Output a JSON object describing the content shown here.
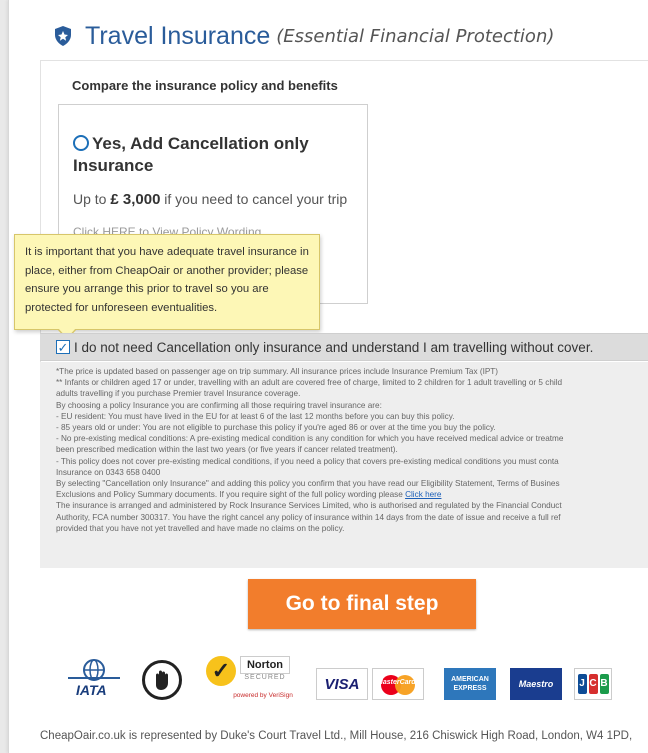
{
  "header": {
    "title": "Travel Insurance",
    "subtitle": "(Essential Financial Protection)",
    "icon": "shield-icon"
  },
  "compare_heading": "Compare the insurance policy and benefits",
  "option": {
    "title": "Yes, Add Cancellation only Insurance",
    "desc_prefix": "Up to",
    "amount": "£ 3,000",
    "desc_suffix": "if you need to cancel your trip",
    "link": "Click HERE to View Policy Wording",
    "link2": "n"
  },
  "tooltip": {
    "text": "It is important that you have adequate travel insurance in place, either from CheapOair or another provider; please ensure you arrange this prior to travel so you are protected for unforeseen eventualities."
  },
  "optout": {
    "checked": true,
    "label": "I do not need Cancellation only insurance and understand I am travelling without cover."
  },
  "fine_print": [
    "*The price is updated based on passenger age on trip summary. All insurance prices include Insurance Premium Tax (IPT)",
    "** Infants or children aged 17 or under, travelling with an adult are covered free of charge, limited to 2 children for 1 adult travelling or 5 child",
    "adults travelling if you purchase Premier travel Insurance coverage.",
    "By choosing a policy Insurance you are confirming all those requiring travel insurance are:",
    "- EU resident: You must have lived in the EU for at least 6 of the last 12 months before you can buy this policy.",
    "- 85 years old or under: You are not eligible to purchase this policy if you're aged 86 or over at the time you buy the policy.",
    "- No pre-existing medical conditions: A pre-existing medical condition is any condition for which you have received medical advice or treatme",
    "been prescribed medication within the last two years (or five years if cancer related treatment).",
    "- This policy does not cover pre-existing medical conditions, if you need a policy that covers pre-existing medical conditions you must conta",
    "Insurance on 0343 658 0400",
    "By selecting \"Cancellation only Insurance\" and adding this policy you confirm that you have read our Eligibility Statement, Terms of Busines",
    "Exclusions and Policy Summary documents. If you require sight of the full policy wording please",
    "The insurance is arranged and administered by Rock Insurance Services Limited, who is authorised and regulated by the Financial Conduct",
    "Authority, FCA number 300317. You have the right cancel any policy of insurance within 14 days from the date of issue and receive a full ref",
    "provided that you have not yet travelled and have made no claims on the policy."
  ],
  "fine_link": "Click here",
  "cta_label": "Go to final step",
  "badges": {
    "iata": "IATA",
    "norton_name": "Norton",
    "norton_secured": "SECURED",
    "norton_powered": "powered by VeriSign",
    "visa": "VISA",
    "mastercard": "MasterCard",
    "amex": "AMERICAN EXPRESS",
    "maestro": "Maestro",
    "jcb": "JCB"
  },
  "footer": "CheapOair.co.uk is represented by Duke's Court Travel Ltd., Mill House, 216 Chiswick High Road, London, W4 1PD,"
}
